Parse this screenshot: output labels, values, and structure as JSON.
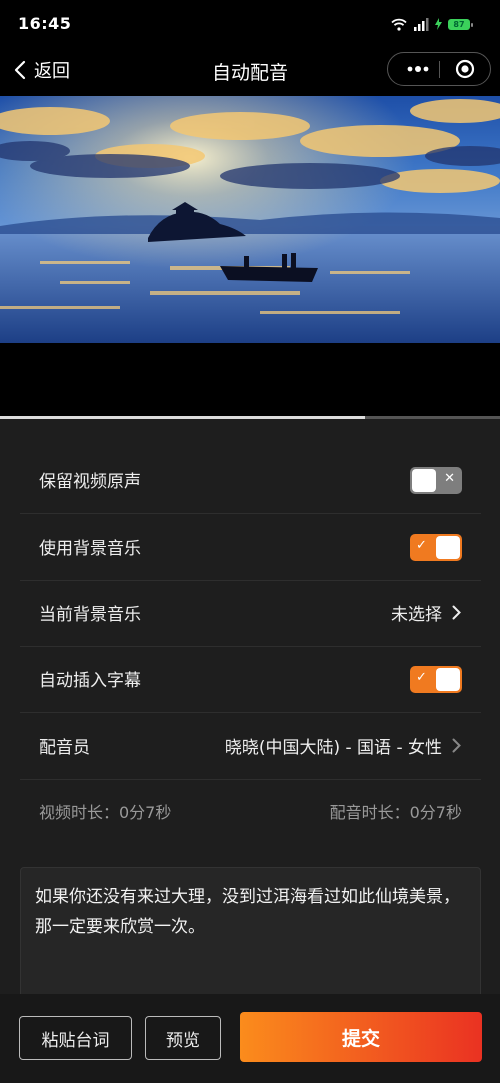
{
  "status_bar": {
    "time": "16:45",
    "battery": "87"
  },
  "nav": {
    "back_label": "返回",
    "title": "自动配音"
  },
  "video": {
    "progress_fraction": 0.73
  },
  "settings": {
    "keep_original_audio": {
      "label": "保留视频原声",
      "enabled": false
    },
    "use_bgm": {
      "label": "使用背景音乐",
      "enabled": true
    },
    "current_bgm": {
      "label": "当前背景音乐",
      "value": "未选择"
    },
    "auto_subtitles": {
      "label": "自动插入字幕",
      "enabled": true
    },
    "voice_actor": {
      "label": "配音员",
      "value": "晓晓(中国大陆) - 国语 - 女性"
    }
  },
  "durations": {
    "video": "视频时长：0分7秒",
    "voiceover": "配音时长：0分7秒"
  },
  "script_text": "如果你还没有来过大理，没到过洱海看过如此仙境美景，那一定要来欣赏一次。",
  "bottom": {
    "paste_label": "粘贴台词",
    "preview_label": "预览",
    "submit_label": "提交"
  },
  "colors": {
    "accent": "#f07a20",
    "submit_gradient_start": "#fb8c1c",
    "submit_gradient_end": "#ea3222",
    "panel_bg": "#1e1e1e"
  }
}
